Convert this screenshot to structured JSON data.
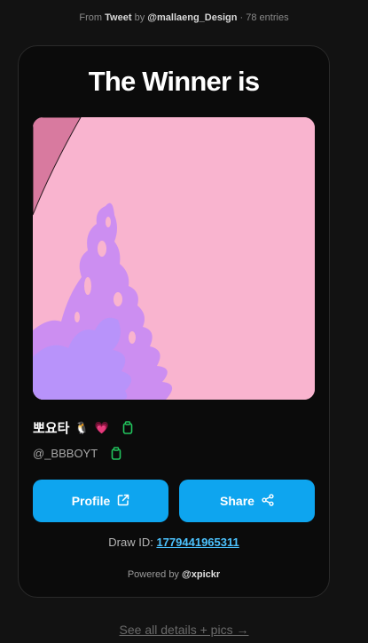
{
  "header": {
    "from_label": "From",
    "source": "Tweet",
    "by_label": "by",
    "author": "@mallaeng_Design",
    "separator": "·",
    "entries": "78 entries"
  },
  "card": {
    "title": "The Winner is",
    "winner": {
      "name": "뽀요타",
      "emoji_1": "🐧",
      "emoji_2": "💗",
      "handle": "@_BBBOYT"
    },
    "buttons": {
      "profile_label": "Profile",
      "share_label": "Share"
    },
    "draw_id_label": "Draw ID:",
    "draw_id": "1779441965311",
    "powered_label": "Powered by",
    "powered_by": "@xpickr"
  },
  "footer": {
    "see_all": "See all details + pics →"
  },
  "icons": {
    "copy": "copy-icon",
    "external_link": "external-link-icon",
    "share": "share-icon"
  },
  "colors": {
    "background": "#121212",
    "card": "#0b0b0b",
    "accent": "#0ea5ef",
    "link": "#4cc3ff",
    "copy_icon": "#22c55e",
    "image_bg": "#f9b4cf"
  }
}
